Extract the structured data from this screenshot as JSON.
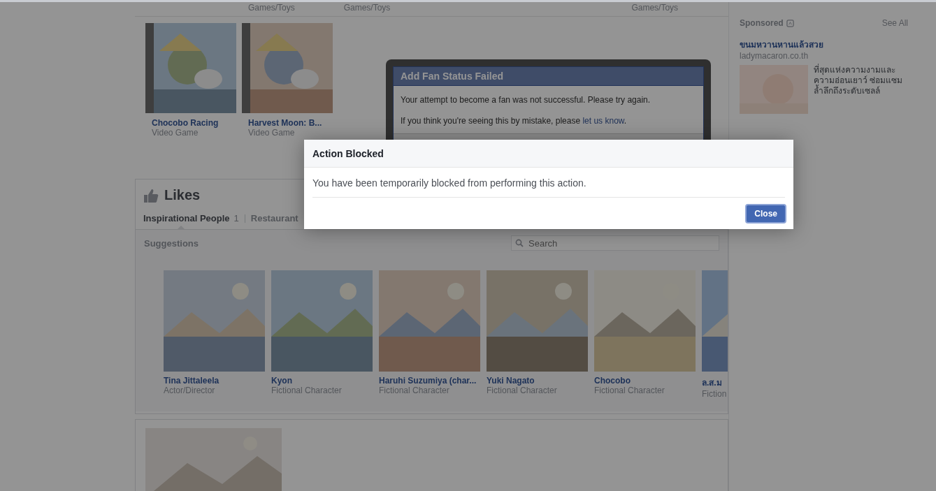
{
  "top_row": {
    "categories": [
      "Games/Toys",
      "Games/Toys",
      "Games/Toys"
    ]
  },
  "games": [
    {
      "title": "Chocobo Racing",
      "category": "Video Game"
    },
    {
      "title": "Harvest Moon: B...",
      "category": "Video Game"
    }
  ],
  "likes": {
    "title": "Likes",
    "tabs": [
      {
        "label": "Inspirational People",
        "count": "1",
        "selected": true
      },
      {
        "label": "Restaurant",
        "selected": false
      }
    ],
    "suggestions_label": "Suggestions",
    "search": {
      "placeholder": "Search"
    },
    "suggestions": [
      {
        "name": "Tina Jittaleela",
        "category": "Actor/Director"
      },
      {
        "name": "Kyon",
        "category": "Fictional Character"
      },
      {
        "name": "Haruhi Suzumiya (char...",
        "category": "Fictional Character"
      },
      {
        "name": "Yuki Nagato",
        "category": "Fictional Character"
      },
      {
        "name": "Chocobo",
        "category": "Fictional Character"
      },
      {
        "name": "ล.ส.ม",
        "category": "Fiction"
      }
    ]
  },
  "sidebar": {
    "sponsored": "Sponsored",
    "see_all": "See All",
    "ad": {
      "title": "ขนมหวานหานแล้วสวย",
      "url": "ladymacaron.co.th",
      "text": "ที่สุดแห่งความงามและความอ่อนเยาว์ ซ่อมแซมล้ำลึกถึงระดับเซลล์"
    }
  },
  "fan_dialog": {
    "title": "Add Fan Status Failed",
    "message": "Your attempt to become a fan was not successful. Please try again.",
    "note": "If you think you're seeing this by mistake, please",
    "link": "let us know",
    "note_end": "."
  },
  "blocked_dialog": {
    "title": "Action Blocked",
    "message": "You have been temporarily blocked from performing this action.",
    "button": "Close"
  }
}
